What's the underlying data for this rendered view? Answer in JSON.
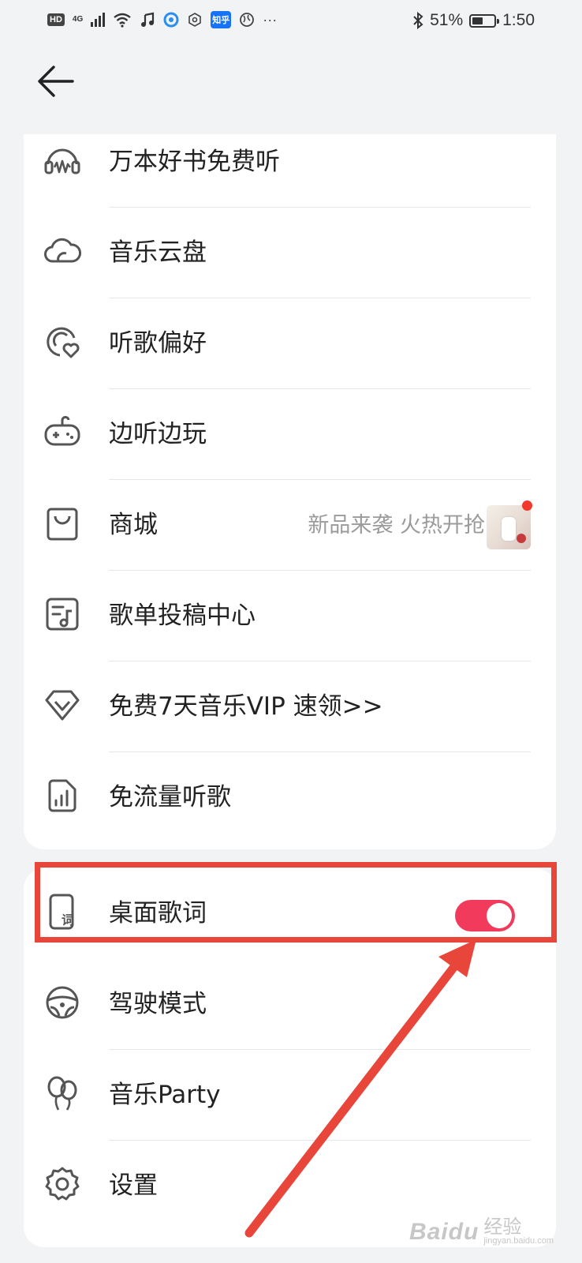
{
  "status_bar": {
    "left_tags": {
      "hd": "HD",
      "network": "4G"
    },
    "battery_percent": "51%",
    "battery_level": 0.51,
    "time": "1:50",
    "zhihu_badge": "知乎"
  },
  "menu_group_1": [
    {
      "label": "万本好书免费听",
      "icon": "audiobook-icon"
    },
    {
      "label": "音乐云盘",
      "icon": "cloud-icon"
    },
    {
      "label": "听歌偏好",
      "icon": "music-preference-icon"
    },
    {
      "label": "边听边玩",
      "icon": "gamepad-icon"
    },
    {
      "label": "商城",
      "icon": "shopping-bag-icon",
      "subtitle": "新品来袭 火热开抢",
      "has_badge": true
    },
    {
      "label": "歌单投稿中心",
      "icon": "playlist-submit-icon"
    },
    {
      "label": "免费7天音乐VIP  速领>>",
      "icon": "diamond-vip-icon"
    },
    {
      "label": "免流量听歌",
      "icon": "sim-data-icon"
    }
  ],
  "menu_group_2": [
    {
      "label": "桌面歌词",
      "icon": "desktop-lyrics-icon",
      "toggle_on": true
    },
    {
      "label": "驾驶模式",
      "icon": "steering-wheel-icon"
    },
    {
      "label": "音乐Party",
      "icon": "balloon-icon"
    },
    {
      "label": "设置",
      "icon": "settings-gear-icon"
    }
  ],
  "watermark": {
    "brand": "Baidu",
    "text": "经验",
    "url": "jingyan.baidu.com"
  },
  "colors": {
    "toggle_active": "#f23a5c",
    "highlight": "#e8463a",
    "badge": "#f2392c"
  }
}
